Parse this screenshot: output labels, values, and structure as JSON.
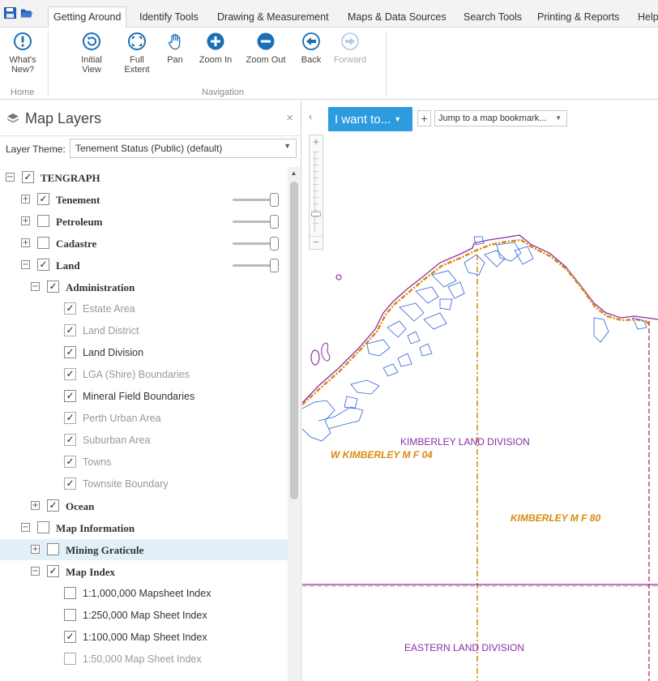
{
  "ribbon": {
    "tabs": [
      {
        "label": "Getting Around",
        "active": true
      },
      {
        "label": "Identify Tools"
      },
      {
        "label": "Drawing & Measurement"
      },
      {
        "label": "Maps & Data Sources"
      },
      {
        "label": "Search Tools"
      },
      {
        "label": "Printing & Reports"
      },
      {
        "label": "Help"
      }
    ],
    "buttons": {
      "whats_new": "What's New?",
      "initial_view": "Initial View",
      "full_extent": "Full Extent",
      "pan": "Pan",
      "zoom_in": "Zoom In",
      "zoom_out": "Zoom Out",
      "back": "Back",
      "forward": "Forward"
    },
    "groups": {
      "home": "Home",
      "navigation": "Navigation"
    },
    "accent_color": "#1a6fb5"
  },
  "layers_panel": {
    "title": "Map Layers",
    "close": "×",
    "theme_label": "Layer Theme:",
    "theme_value": "Tenement Status (Public) (default)",
    "items": [
      {
        "label": "TENGRAPH",
        "checked": true,
        "expand": "−"
      },
      {
        "label": "Tenement",
        "checked": true,
        "expand": "+"
      },
      {
        "label": "Petroleum",
        "checked": false,
        "expand": "+"
      },
      {
        "label": "Cadastre",
        "checked": false,
        "expand": "+"
      },
      {
        "label": "Land",
        "checked": true,
        "expand": "−"
      },
      {
        "label": "Administration",
        "checked": true,
        "expand": "−"
      },
      {
        "label": "Estate Area",
        "checked": true
      },
      {
        "label": "Land District",
        "checked": true
      },
      {
        "label": "Land Division",
        "checked": true
      },
      {
        "label": "LGA (Shire) Boundaries",
        "checked": true
      },
      {
        "label": "Mineral Field Boundaries",
        "checked": true
      },
      {
        "label": "Perth Urban Area",
        "checked": true
      },
      {
        "label": "Suburban Area",
        "checked": true
      },
      {
        "label": "Towns",
        "checked": true
      },
      {
        "label": "Townsite Boundary",
        "checked": true
      },
      {
        "label": "Ocean",
        "checked": true,
        "expand": "+"
      },
      {
        "label": "Map Information",
        "checked": false,
        "expand": "−"
      },
      {
        "label": "Mining Graticule",
        "checked": false,
        "expand": "+"
      },
      {
        "label": "Map Index",
        "checked": true,
        "expand": "−"
      },
      {
        "label": "1:1,000,000 Mapsheet Index",
        "checked": false
      },
      {
        "label": "1:250,000 Map Sheet Index",
        "checked": false
      },
      {
        "label": "1:100,000 Map Sheet Index",
        "checked": true
      },
      {
        "label": "1:50,000 Map Sheet Index",
        "checked": false
      }
    ]
  },
  "map": {
    "i_want_to": "I want to...",
    "bookmark_placeholder": "Jump to a map bookmark...",
    "labels": {
      "kimberley_land_division": "KIMBERLEY LAND DIVISION",
      "w_kimberley_mf04": "W KIMBERLEY M F 04",
      "kimberley_mf80": "KIMBERLEY M F 80",
      "eastern_land_division": "EASTERN LAND DIVISION"
    },
    "colors": {
      "coast": "#2b5fd9",
      "land_division": "#8c2da8",
      "mineral_field": "#d98b10",
      "sheet_index": "#b02020"
    }
  }
}
